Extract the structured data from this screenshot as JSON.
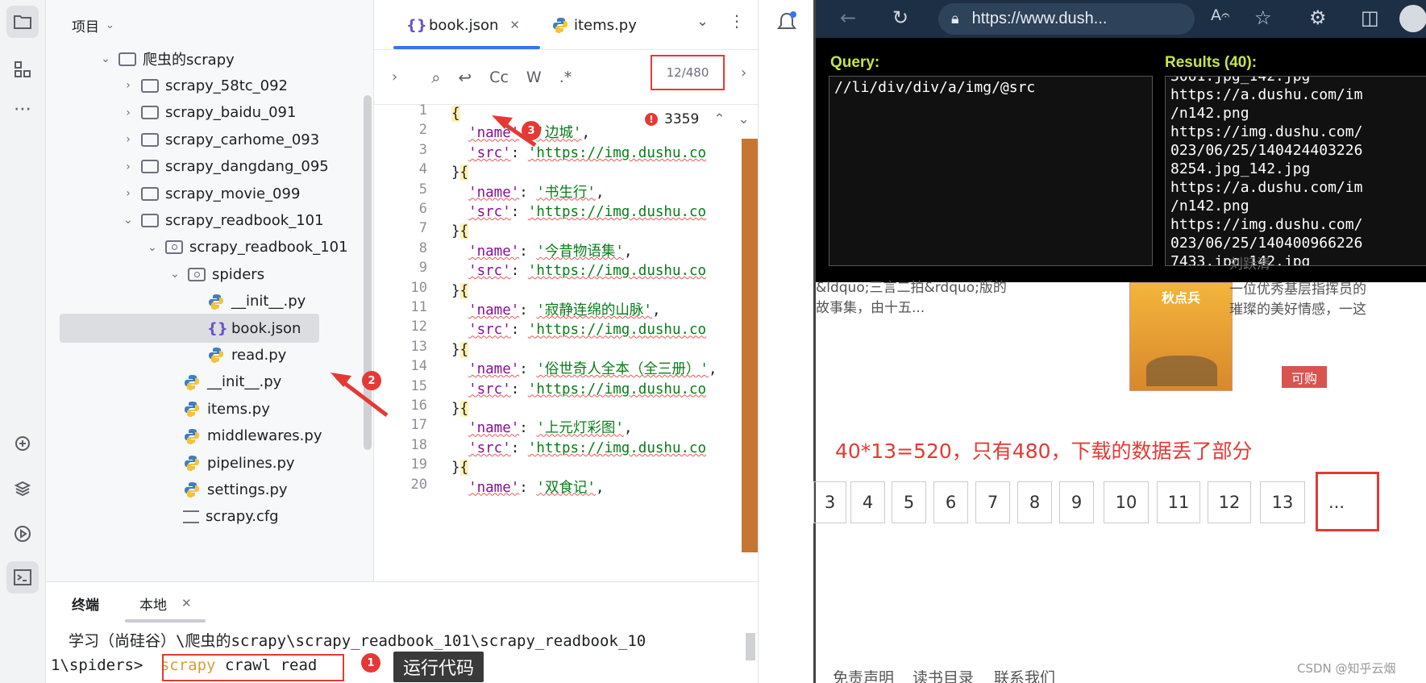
{
  "ide": {
    "project_title": "项目",
    "tree": [
      {
        "label": "爬虫的scrapy",
        "kind": "folder",
        "open": true
      },
      {
        "label": "scrapy_58tc_092",
        "kind": "folder"
      },
      {
        "label": "scrapy_baidu_091",
        "kind": "folder"
      },
      {
        "label": "scrapy_carhome_093",
        "kind": "folder"
      },
      {
        "label": "scrapy_dangdang_095",
        "kind": "folder"
      },
      {
        "label": "scrapy_movie_099",
        "kind": "folder"
      },
      {
        "label": "scrapy_readbook_101",
        "kind": "folder",
        "open": true
      },
      {
        "label": "scrapy_readbook_101",
        "kind": "package",
        "open": true
      },
      {
        "label": "spiders",
        "kind": "package",
        "open": true
      },
      {
        "label": "__init__.py",
        "kind": "python"
      },
      {
        "label": "book.json",
        "kind": "json",
        "selected": true
      },
      {
        "label": "read.py",
        "kind": "python"
      },
      {
        "label": "__init__.py",
        "kind": "python"
      },
      {
        "label": "items.py",
        "kind": "python"
      },
      {
        "label": "middlewares.py",
        "kind": "python"
      },
      {
        "label": "pipelines.py",
        "kind": "python"
      },
      {
        "label": "settings.py",
        "kind": "python"
      },
      {
        "label": "scrapy.cfg",
        "kind": "config"
      }
    ],
    "tabs": [
      {
        "label": "book.json",
        "icon": "json-icon",
        "active": true,
        "close": "✕"
      },
      {
        "label": "items.py",
        "icon": "python-icon",
        "active": false
      }
    ],
    "search_count": "12/480",
    "warning_count": "3359",
    "line_numbers": [
      "1",
      "2",
      "3",
      "4",
      "5",
      "6",
      "7",
      "8",
      "9",
      "10",
      "11",
      "12",
      "13",
      "14",
      "15",
      "16",
      "17",
      "18",
      "19",
      "20"
    ],
    "code_lines": [
      {
        "kind": "open"
      },
      {
        "kind": "name",
        "key": "'name'",
        "value": "'边城'"
      },
      {
        "kind": "src",
        "key": "'src'",
        "value": "'https://img.dushu.co"
      },
      {
        "kind": "sep"
      },
      {
        "kind": "name",
        "key": "'name'",
        "value": "'书生行'"
      },
      {
        "kind": "src",
        "key": "'src'",
        "value": "'https://img.dushu.co"
      },
      {
        "kind": "sep"
      },
      {
        "kind": "name",
        "key": "'name'",
        "value": "'今昔物语集'"
      },
      {
        "kind": "src",
        "key": "'src'",
        "value": "'https://img.dushu.co"
      },
      {
        "kind": "sep"
      },
      {
        "kind": "name",
        "key": "'name'",
        "value": "'寂静连绵的山脉'"
      },
      {
        "kind": "src",
        "key": "'src'",
        "value": "'https://img.dushu.co"
      },
      {
        "kind": "sep"
      },
      {
        "kind": "name",
        "key": "'name'",
        "value": "'俗世奇人全本（全三册）'"
      },
      {
        "kind": "src",
        "key": "'src'",
        "value": "'https://img.dushu.co"
      },
      {
        "kind": "sep"
      },
      {
        "kind": "name",
        "key": "'name'",
        "value": "'上元灯彩图'"
      },
      {
        "kind": "src",
        "key": "'src'",
        "value": "'https://img.dushu.co"
      },
      {
        "kind": "sep"
      },
      {
        "kind": "name",
        "key": "'name'",
        "value": "'双食记'"
      }
    ],
    "terminal": {
      "tab_terminal": "终端",
      "tab_local": "本地",
      "path_line": "学习（尚硅谷）\\爬虫的scrapy\\scrapy_readbook_101\\scrapy_readbook_10",
      "prompt": "1\\spiders>",
      "command_head": "scrapy",
      "command_rest": "crawl read"
    },
    "markers": [
      "1",
      "2",
      "3"
    ],
    "callout": "运行代码"
  },
  "browser": {
    "url": "https://www.dush...",
    "query_label": "Query:",
    "query": "//li/div/div/a/img/@src",
    "results_label": "Results (40):",
    "results_lines": [
      "3061.jpg_142.jpg",
      "https://a.dushu.com/im",
      "/n142.png",
      "https://img.dushu.com/",
      "023/06/25/140424403226",
      "8254.jpg_142.jpg",
      "https://a.dushu.com/im",
      "/n142.png",
      "https://img.dushu.com/",
      "023/06/25/140400966226",
      "7433.jpg_142.jpg"
    ],
    "author": "刘跃清",
    "desc_left_1": "&ldquo;三言二拍&rdquo;版的",
    "desc_left_2": "故事集，由十五...",
    "desc_right_1": "一位优秀基层指挥员的",
    "desc_right_2": "璀璨的美好情感，一这",
    "book_cover_title": "秋点兵",
    "buy_label": "可购",
    "note": "40*13=520，只有480，下载的数据丢了部分",
    "pages": [
      "3",
      "4",
      "5",
      "6",
      "7",
      "8",
      "9",
      "10",
      "11",
      "12",
      "13",
      "..."
    ],
    "highlight_page": "13",
    "footer": [
      "免责声明",
      "读书目录",
      "联系我们"
    ],
    "watermark": "CSDN @知乎云烟"
  }
}
